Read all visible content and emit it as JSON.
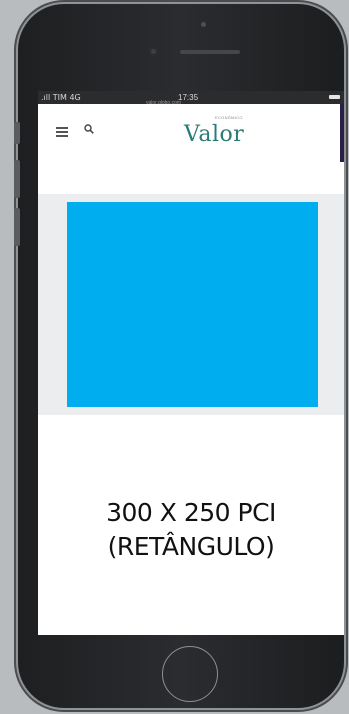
{
  "status_bar": {
    "carrier": ".ıll TIM  4G",
    "time": "17:35",
    "url": "valor.globo.com"
  },
  "nav": {
    "menu_icon": "hamburger-menu-icon",
    "search_icon": "search-icon",
    "logo_text": "Valor",
    "logo_superscript": "ECONÔMICO"
  },
  "ad": {
    "color": "#00aeef",
    "caption_line1": "300 X 250 PCI",
    "caption_line2": "(RETÂNGULO)"
  },
  "colors": {
    "logo": "#2a7a78",
    "ad_fill": "#00aeef",
    "phone_body": "#2b2c2f"
  }
}
